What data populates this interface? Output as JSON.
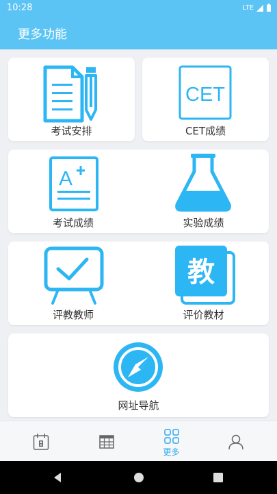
{
  "status": {
    "time": "10:28",
    "network": "LTE"
  },
  "app": {
    "title": "更多功能"
  },
  "tiles": {
    "exam_schedule": "考试安排",
    "cet_score": "CET成绩",
    "cet_icon_text": "CET",
    "exam_score": "考试成绩",
    "grade_icon_text": "A",
    "lab_score": "实验成绩",
    "evaluate_teaching": "评教教师",
    "evaluate_textbook": "评价教材",
    "textbook_icon_text": "教",
    "url_nav": "网址导航"
  },
  "bottom_nav": {
    "active_color": "#2aa9f0",
    "items": [
      {
        "icon": "calendar-icon"
      },
      {
        "icon": "table-icon"
      },
      {
        "icon": "grid-icon",
        "label": "更多",
        "active": true
      },
      {
        "icon": "user-icon"
      }
    ]
  },
  "colors": {
    "accent": "#5bc4f5",
    "icon_blue": "#2cb6f4"
  }
}
